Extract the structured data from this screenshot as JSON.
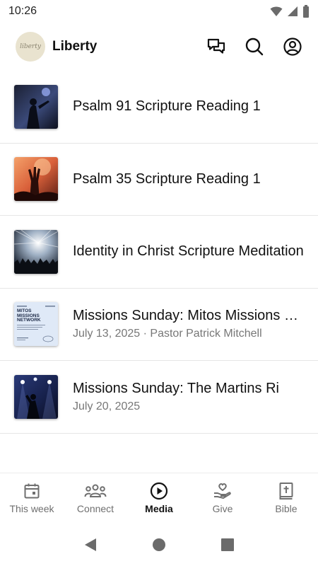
{
  "status_bar": {
    "time": "10:26"
  },
  "header": {
    "title": "Liberty",
    "logo_text": "liberty"
  },
  "media": {
    "items": [
      {
        "title": "Psalm 91 Scripture Reading 1",
        "subtitle": ""
      },
      {
        "title": "Psalm 35 Scripture Reading 1",
        "subtitle": ""
      },
      {
        "title": "Identity in Christ Scripture Meditation",
        "subtitle": ""
      },
      {
        "title": "Missions Sunday: Mitos Missions Network",
        "subtitle": "July 13, 2025 · Pastor Patrick Mitchell",
        "thumb_text": "MITOS MISSIONS NETWORK"
      },
      {
        "title": "Missions Sunday: The Martins Ri",
        "subtitle": "July 20, 2025"
      }
    ]
  },
  "bottom_nav": {
    "tabs": [
      {
        "label": "This week",
        "icon": "calendar-icon"
      },
      {
        "label": "Connect",
        "icon": "people-icon"
      },
      {
        "label": "Media",
        "icon": "play-circle-icon",
        "active": true
      },
      {
        "label": "Give",
        "icon": "heart-hand-icon"
      },
      {
        "label": "Bible",
        "icon": "bible-icon"
      }
    ]
  },
  "colors": {
    "active_tab": "#111111",
    "inactive_tab": "#6f6f6f",
    "divider": "#e6e6e6"
  }
}
